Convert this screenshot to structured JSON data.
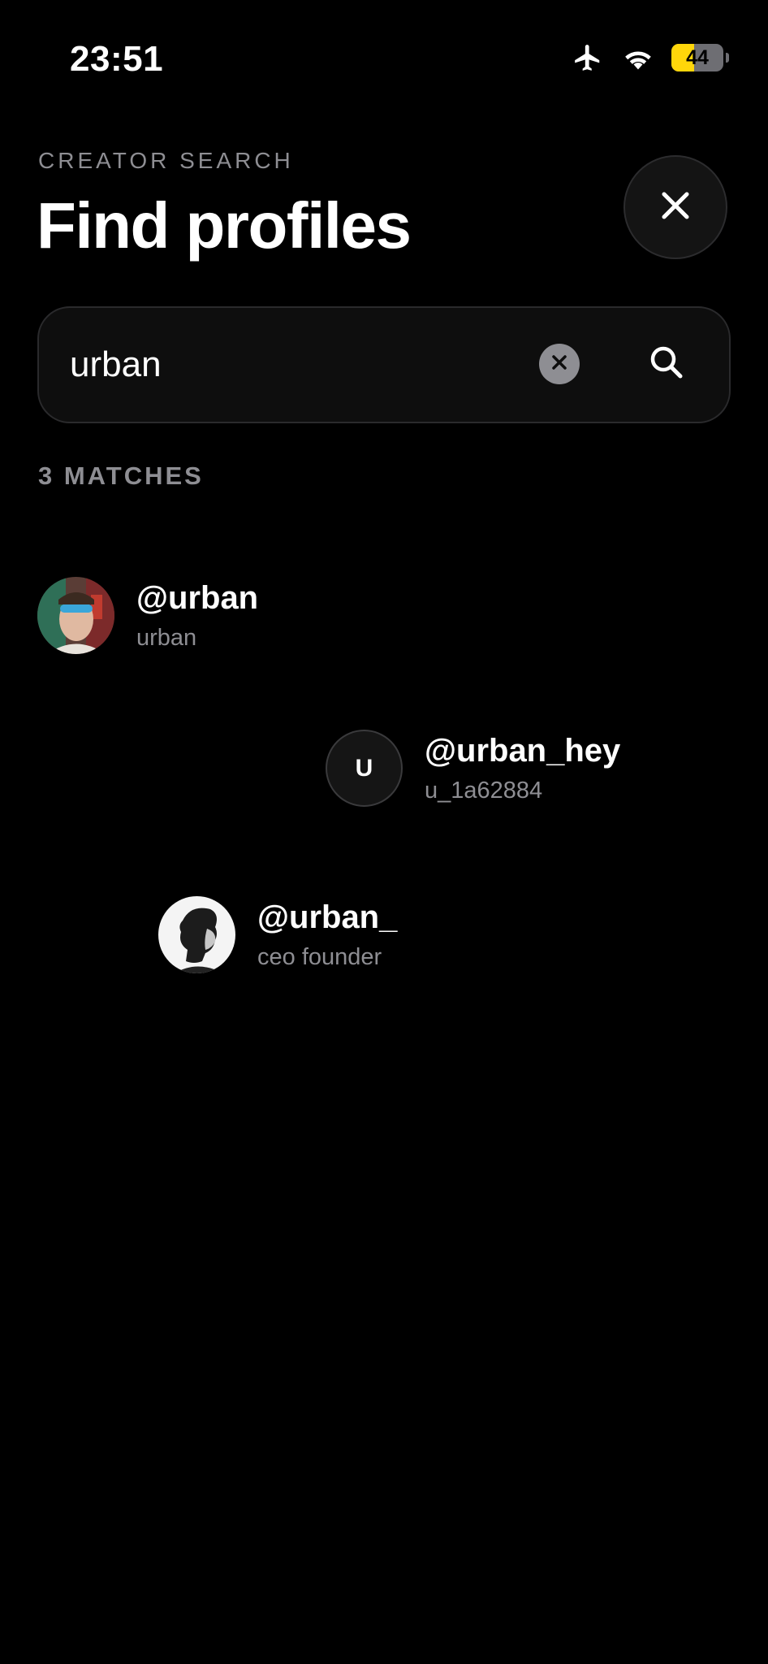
{
  "status_bar": {
    "time": "23:51",
    "battery_level": "44",
    "battery_fraction": 0.44,
    "icons": [
      "airplane-icon",
      "wifi-icon",
      "battery-icon"
    ]
  },
  "header": {
    "eyebrow": "CREATOR SEARCH",
    "title": "Find profiles",
    "close_icon": "close-icon"
  },
  "search": {
    "value": "urban",
    "clear_icon": "clear-icon",
    "search_icon": "search-icon"
  },
  "results_summary": "3 MATCHES",
  "results": [
    {
      "handle": "@urban",
      "subtitle": "urban",
      "avatar": "photo"
    },
    {
      "handle": "@urban_hey",
      "subtitle": "u_1a62884",
      "avatar": "initial",
      "initial": "U"
    },
    {
      "handle": "@urban_",
      "subtitle": "ceo founder",
      "avatar": "photo"
    }
  ],
  "colors": {
    "background": "#000000",
    "secondary_text": "#8e8e93",
    "battery_accent": "#ffd60a"
  }
}
